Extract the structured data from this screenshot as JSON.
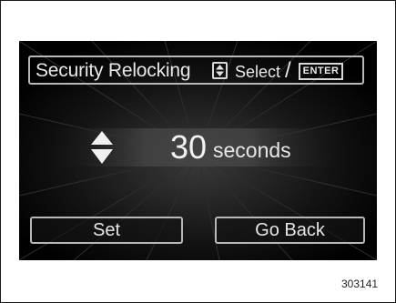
{
  "title_bar": {
    "title": "Security Relocking",
    "select_label": "Select",
    "separator": "/",
    "enter_label": "ENTER",
    "updown_icon": "up-down-arrow-icon"
  },
  "setting": {
    "value": "30",
    "unit": "seconds",
    "adjust_icon": "up-down-arrow-icon"
  },
  "buttons": {
    "set_label": "Set",
    "back_label": "Go Back"
  },
  "figure_number": "303141",
  "colors": {
    "screen_background": "#000000",
    "text": "#e8e8e8",
    "border": "#b8b8b8",
    "page_background": "#ffffff"
  }
}
